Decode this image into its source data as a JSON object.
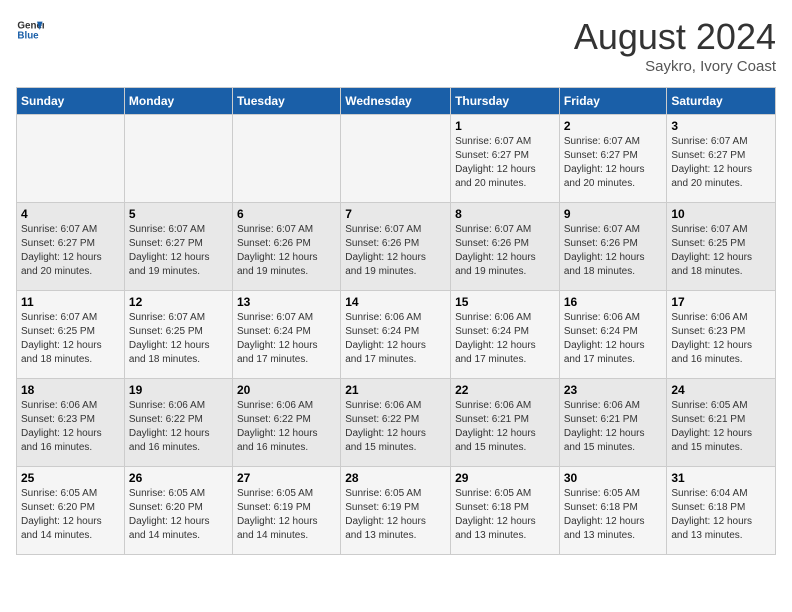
{
  "header": {
    "logo_line1": "General",
    "logo_line2": "Blue",
    "title": "August 2024",
    "subtitle": "Saykro, Ivory Coast"
  },
  "days_of_week": [
    "Sunday",
    "Monday",
    "Tuesday",
    "Wednesday",
    "Thursday",
    "Friday",
    "Saturday"
  ],
  "weeks": [
    [
      {
        "day": "",
        "info": ""
      },
      {
        "day": "",
        "info": ""
      },
      {
        "day": "",
        "info": ""
      },
      {
        "day": "",
        "info": ""
      },
      {
        "day": "1",
        "info": "Sunrise: 6:07 AM\nSunset: 6:27 PM\nDaylight: 12 hours\nand 20 minutes."
      },
      {
        "day": "2",
        "info": "Sunrise: 6:07 AM\nSunset: 6:27 PM\nDaylight: 12 hours\nand 20 minutes."
      },
      {
        "day": "3",
        "info": "Sunrise: 6:07 AM\nSunset: 6:27 PM\nDaylight: 12 hours\nand 20 minutes."
      }
    ],
    [
      {
        "day": "4",
        "info": "Sunrise: 6:07 AM\nSunset: 6:27 PM\nDaylight: 12 hours\nand 20 minutes."
      },
      {
        "day": "5",
        "info": "Sunrise: 6:07 AM\nSunset: 6:27 PM\nDaylight: 12 hours\nand 19 minutes."
      },
      {
        "day": "6",
        "info": "Sunrise: 6:07 AM\nSunset: 6:26 PM\nDaylight: 12 hours\nand 19 minutes."
      },
      {
        "day": "7",
        "info": "Sunrise: 6:07 AM\nSunset: 6:26 PM\nDaylight: 12 hours\nand 19 minutes."
      },
      {
        "day": "8",
        "info": "Sunrise: 6:07 AM\nSunset: 6:26 PM\nDaylight: 12 hours\nand 19 minutes."
      },
      {
        "day": "9",
        "info": "Sunrise: 6:07 AM\nSunset: 6:26 PM\nDaylight: 12 hours\nand 18 minutes."
      },
      {
        "day": "10",
        "info": "Sunrise: 6:07 AM\nSunset: 6:25 PM\nDaylight: 12 hours\nand 18 minutes."
      }
    ],
    [
      {
        "day": "11",
        "info": "Sunrise: 6:07 AM\nSunset: 6:25 PM\nDaylight: 12 hours\nand 18 minutes."
      },
      {
        "day": "12",
        "info": "Sunrise: 6:07 AM\nSunset: 6:25 PM\nDaylight: 12 hours\nand 18 minutes."
      },
      {
        "day": "13",
        "info": "Sunrise: 6:07 AM\nSunset: 6:24 PM\nDaylight: 12 hours\nand 17 minutes."
      },
      {
        "day": "14",
        "info": "Sunrise: 6:06 AM\nSunset: 6:24 PM\nDaylight: 12 hours\nand 17 minutes."
      },
      {
        "day": "15",
        "info": "Sunrise: 6:06 AM\nSunset: 6:24 PM\nDaylight: 12 hours\nand 17 minutes."
      },
      {
        "day": "16",
        "info": "Sunrise: 6:06 AM\nSunset: 6:24 PM\nDaylight: 12 hours\nand 17 minutes."
      },
      {
        "day": "17",
        "info": "Sunrise: 6:06 AM\nSunset: 6:23 PM\nDaylight: 12 hours\nand 16 minutes."
      }
    ],
    [
      {
        "day": "18",
        "info": "Sunrise: 6:06 AM\nSunset: 6:23 PM\nDaylight: 12 hours\nand 16 minutes."
      },
      {
        "day": "19",
        "info": "Sunrise: 6:06 AM\nSunset: 6:22 PM\nDaylight: 12 hours\nand 16 minutes."
      },
      {
        "day": "20",
        "info": "Sunrise: 6:06 AM\nSunset: 6:22 PM\nDaylight: 12 hours\nand 16 minutes."
      },
      {
        "day": "21",
        "info": "Sunrise: 6:06 AM\nSunset: 6:22 PM\nDaylight: 12 hours\nand 15 minutes."
      },
      {
        "day": "22",
        "info": "Sunrise: 6:06 AM\nSunset: 6:21 PM\nDaylight: 12 hours\nand 15 minutes."
      },
      {
        "day": "23",
        "info": "Sunrise: 6:06 AM\nSunset: 6:21 PM\nDaylight: 12 hours\nand 15 minutes."
      },
      {
        "day": "24",
        "info": "Sunrise: 6:05 AM\nSunset: 6:21 PM\nDaylight: 12 hours\nand 15 minutes."
      }
    ],
    [
      {
        "day": "25",
        "info": "Sunrise: 6:05 AM\nSunset: 6:20 PM\nDaylight: 12 hours\nand 14 minutes."
      },
      {
        "day": "26",
        "info": "Sunrise: 6:05 AM\nSunset: 6:20 PM\nDaylight: 12 hours\nand 14 minutes."
      },
      {
        "day": "27",
        "info": "Sunrise: 6:05 AM\nSunset: 6:19 PM\nDaylight: 12 hours\nand 14 minutes."
      },
      {
        "day": "28",
        "info": "Sunrise: 6:05 AM\nSunset: 6:19 PM\nDaylight: 12 hours\nand 13 minutes."
      },
      {
        "day": "29",
        "info": "Sunrise: 6:05 AM\nSunset: 6:18 PM\nDaylight: 12 hours\nand 13 minutes."
      },
      {
        "day": "30",
        "info": "Sunrise: 6:05 AM\nSunset: 6:18 PM\nDaylight: 12 hours\nand 13 minutes."
      },
      {
        "day": "31",
        "info": "Sunrise: 6:04 AM\nSunset: 6:18 PM\nDaylight: 12 hours\nand 13 minutes."
      }
    ]
  ]
}
